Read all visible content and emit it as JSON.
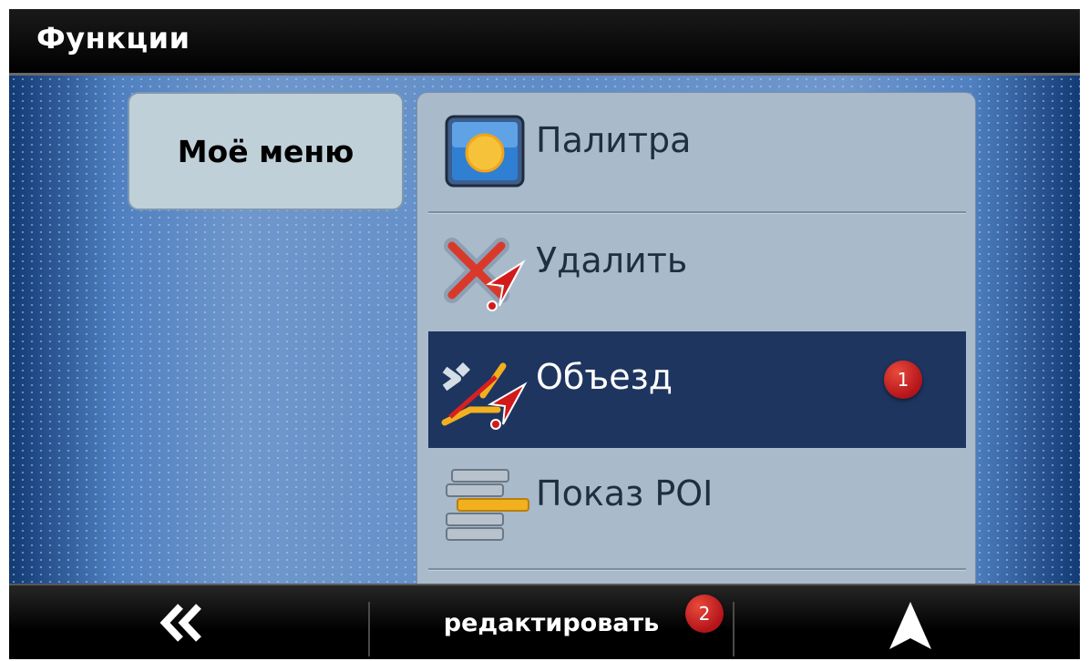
{
  "header": {
    "title": "Функции"
  },
  "sidebar": {
    "my_menu_label": "Моё меню"
  },
  "menu": {
    "items": [
      {
        "label": "Палитра",
        "icon": "palette-icon",
        "selected": false
      },
      {
        "label": "Удалить",
        "icon": "delete-route-icon",
        "selected": false
      },
      {
        "label": "Объезд",
        "icon": "detour-icon",
        "selected": true
      },
      {
        "label": "Показ POI",
        "icon": "show-poi-icon",
        "selected": false
      }
    ]
  },
  "annotations": {
    "badge_1": "1",
    "badge_2": "2"
  },
  "footer": {
    "back_icon": "double-chevron-left-icon",
    "edit_label": "редактировать",
    "navigate_icon": "navigation-arrow-icon"
  },
  "colors": {
    "header_bg": "#000000",
    "selected_item_bg": "#1e3560",
    "panel_bg": "#a9bacb",
    "badge_red": "#c0161c"
  }
}
